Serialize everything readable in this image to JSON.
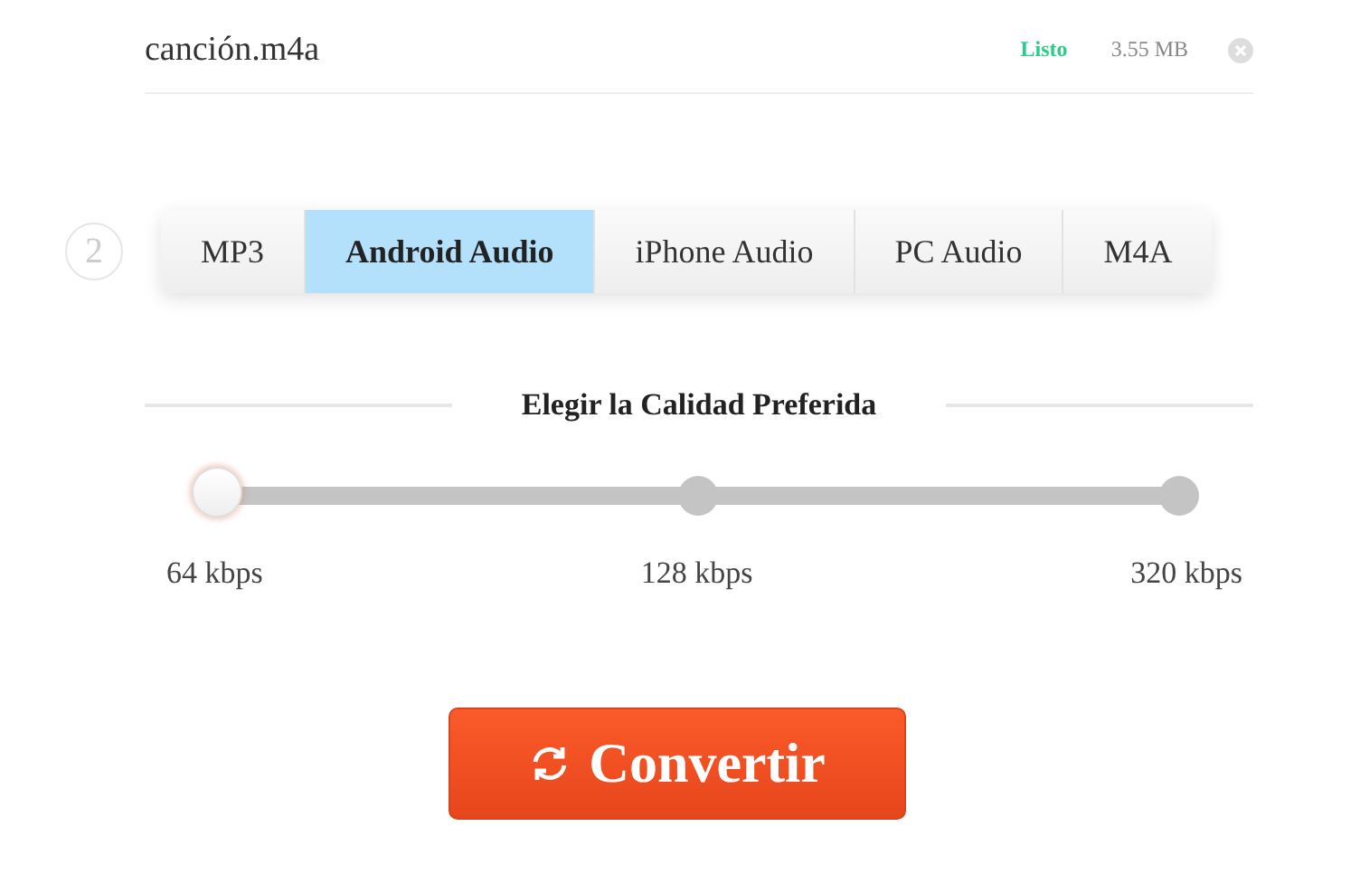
{
  "file": {
    "name": "canción.m4a",
    "status": "Listo",
    "size": "3.55 MB"
  },
  "step": "2",
  "tabs": [
    {
      "label": "MP3",
      "selected": false
    },
    {
      "label": "Android Audio",
      "selected": true
    },
    {
      "label": "iPhone Audio",
      "selected": false
    },
    {
      "label": "PC Audio",
      "selected": false
    },
    {
      "label": "M4A",
      "selected": false
    }
  ],
  "quality": {
    "title": "Elegir la Calidad Preferida",
    "options": [
      {
        "label": "64 kbps",
        "selected": true
      },
      {
        "label": "128 kbps",
        "selected": false
      },
      {
        "label": "320 kbps",
        "selected": false
      }
    ]
  },
  "button": "Convertir"
}
